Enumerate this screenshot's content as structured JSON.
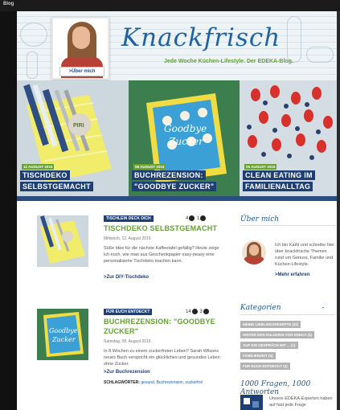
{
  "window": {
    "title": "Blog"
  },
  "header": {
    "logo": "Knackfrisch",
    "tagline": "Jede Woche Küchen-Lifestyle. Der EDEKA-Blog.",
    "profile_button": ">Über mich"
  },
  "features": [
    {
      "date": "12 AUGUST 2015",
      "line1": "TISCHDEKO",
      "line2": "SELBSTGEMACHT"
    },
    {
      "date": "08 AUGUST 2015",
      "line1": "BUCHREZENSION:",
      "line2": "\"GOODBYE ZUCKER\""
    },
    {
      "date": "05 AUGUST 2015",
      "line1": "CLEAN EATING IM",
      "line2": "FAMILIENALLTAG"
    }
  ],
  "posts": [
    {
      "category": "TISCHLEIN DECK DICH",
      "title": "TISCHDEKO SELBSTGEMACHT",
      "likes": "4",
      "comments": "1",
      "date": "Mittwoch, 12. August 2015",
      "excerpt": "Süße Idee für die nächste Kaffeetafel gefällig? Heute zeige ich euch, wie man aus Geschenkpapier easy-peasy eine personalisierte Tischdeko machen kann.",
      "more": ">Zur DIY-Tischdeko"
    },
    {
      "category": "FÜR EUCH ENTDECKT",
      "title": "BUCHREZENSION: \"GOODBYE ZUCKER\"",
      "likes": "14",
      "comments": "3",
      "date": "Samstag, 08. August 2015",
      "excerpt": "In 8 Wochen zu einem zuckerfreien Leben? Sarah Wilsons neues Buch verspricht ein glückliches und gesundes Leben ohne Zucker.",
      "more": ">Zur Buchrezension",
      "tags_label": "SCHLAGWÖRTER:",
      "tags": "gesund, Buchrezension, zuckerfrei"
    }
  ],
  "sidebar": {
    "about_heading": "Über mich",
    "about_text": "Ich bin Kathi und schreibe hier über knackfrische Themen rund um Genuss, Familie und Küchen-Lifestyle.",
    "about_more": ">Mehr erfahren",
    "categories_heading": "Kategorien",
    "categories": [
      "MEINE LIEBLINGSREZEPTE (11)",
      "HINTER DEN KULISSEN VON EDEKA (1)",
      "AUF EIN GESPRÄCH MIT ... (1)",
      "FAMILIENZEIT (6)",
      "FÜR EUCH ENTDECKT (3)"
    ],
    "questions_heading": "1000 Fragen, 1000 Antworten",
    "questions_text": "Unsere EDEKA-Experten haben auf fast jede Frage"
  },
  "colors": {
    "brand_blue": "#1e3f73",
    "brand_green": "#62a32f",
    "logo_blue": "#1f63a3"
  }
}
